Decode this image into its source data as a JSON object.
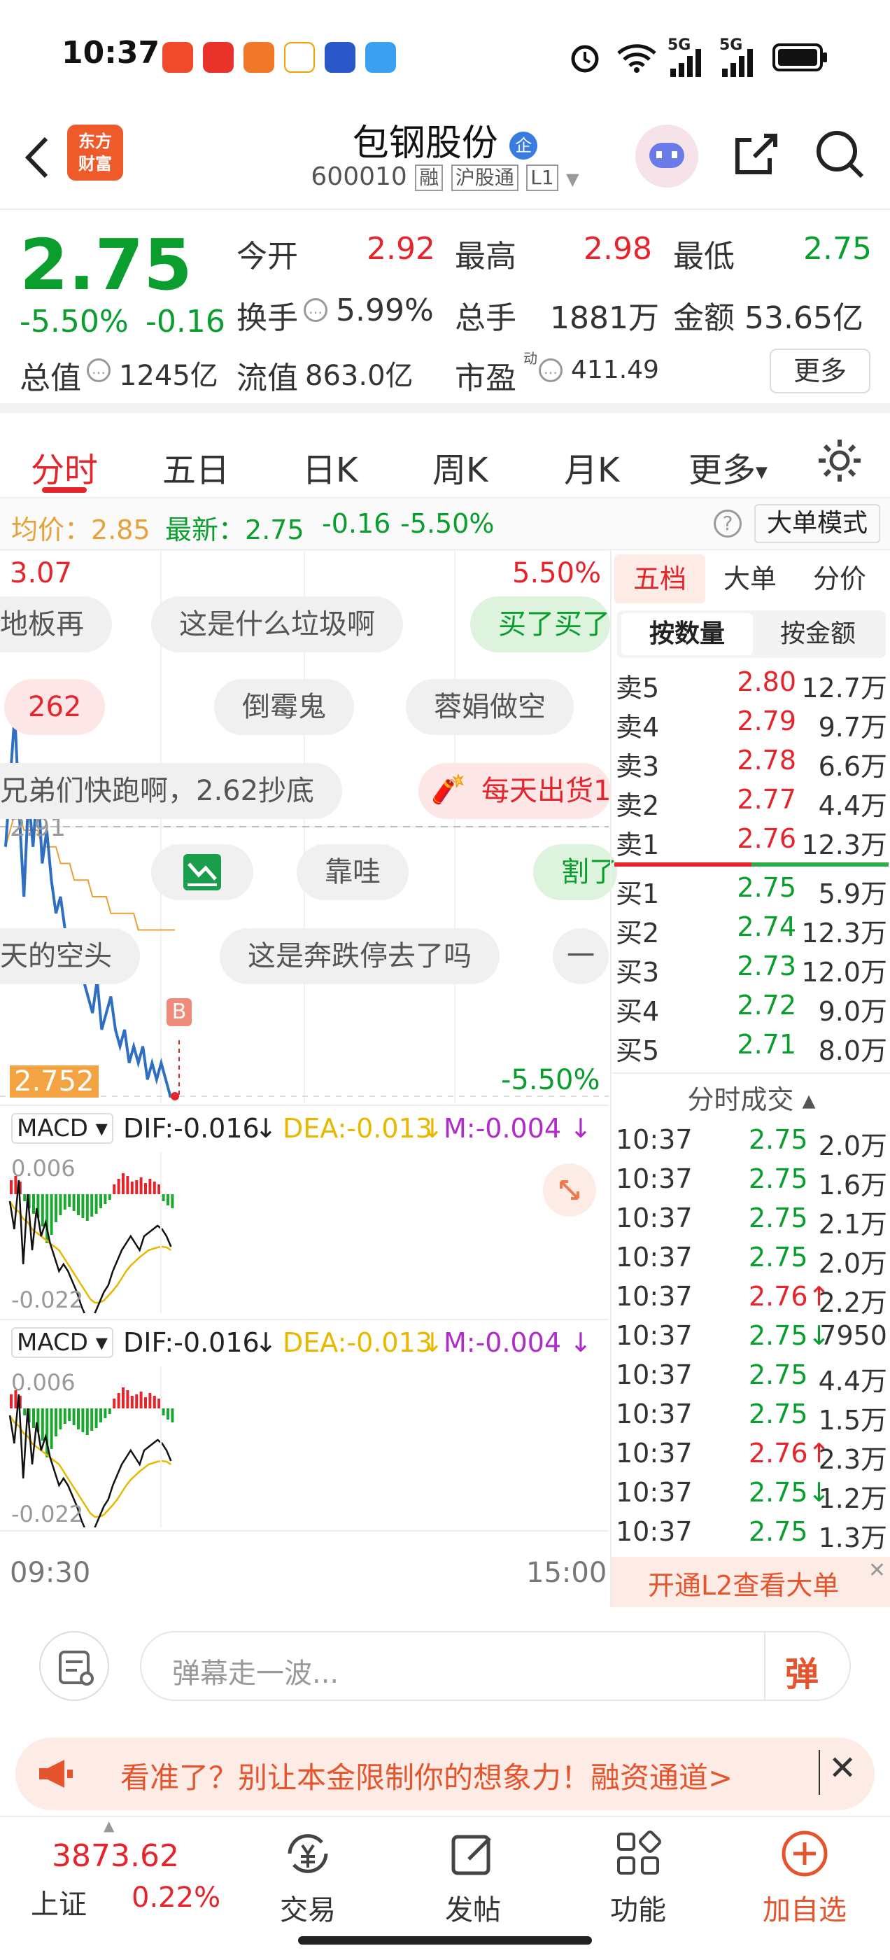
{
  "status": {
    "time": "10:37",
    "signal1": "5G",
    "signal2": "5G"
  },
  "header": {
    "logo_line1": "东方",
    "logo_line2": "财富",
    "name": "包钢股份",
    "badge": "企",
    "code": "600010",
    "tag_rong": "融",
    "tag_hgt": "沪股通",
    "tag_level": "L1"
  },
  "quote": {
    "price": "2.75",
    "change_pct": "-5.50%",
    "change": "-0.16",
    "open_label": "今开",
    "open": "2.92",
    "high_label": "最高",
    "high": "2.98",
    "low_label": "最低",
    "low": "2.75",
    "turnover_label": "换手",
    "turnover": "5.99%",
    "volume_label": "总手",
    "volume": "1881万",
    "amount_label": "金额",
    "amount": "53.65亿",
    "mcap_label": "总值",
    "mcap": "1245亿",
    "float_label": "流值",
    "float": "863.0亿",
    "pe_label": "市盈",
    "pe_sup": "动",
    "pe": "411.49",
    "more": "更多"
  },
  "tabs": [
    "分时",
    "五日",
    "日K",
    "周K",
    "月K",
    "更多"
  ],
  "info": {
    "avg_label": "均价：",
    "avg": "2.85",
    "latest_label": "最新：",
    "latest": "2.75",
    "chg": "-0.16",
    "pct": "-5.50%",
    "bigorder": "大单模式"
  },
  "chart": {
    "max_price": "3.07",
    "max_pct": "5.50%",
    "ref_price": "2.91",
    "min_price": "2.752",
    "min_pct": "-5.50%",
    "b_marker": "B",
    "danmaku": [
      "地板再",
      "这是什么垃圾啊",
      "买了买了",
      "262",
      "倒霉鬼",
      "蓉娟做空",
      "兄弟们快跑啊，2.62抄底",
      "每天出货1",
      "靠哇",
      "割了",
      "天的空头",
      "这是奔跌停去了吗",
      "一"
    ],
    "macd1": {
      "label": "MACD",
      "dif": "DIF:-0.016",
      "dea": "DEA:-0.013",
      "m": "M:-0.004",
      "top": "0.006",
      "bottom": "-0.022"
    },
    "macd2": {
      "label": "MACD",
      "dif": "DIF:-0.016",
      "dea": "DEA:-0.013",
      "m": "M:-0.004",
      "top": "0.006",
      "bottom": "-0.022"
    },
    "time_start": "09:30",
    "time_end": "15:00",
    "price_series": [
      2.9,
      2.94,
      2.98,
      2.92,
      2.87,
      2.93,
      2.9,
      2.94,
      2.89,
      2.91,
      2.88,
      2.86,
      2.87,
      2.85,
      2.84,
      2.83,
      2.84,
      2.82,
      2.81,
      2.8,
      2.82,
      2.79,
      2.8,
      2.81,
      2.79,
      2.78,
      2.79,
      2.77,
      2.78,
      2.77,
      2.78,
      2.76,
      2.77,
      2.76,
      2.77,
      2.76,
      2.75,
      2.75
    ],
    "avg_series": [
      2.9,
      2.91,
      2.92,
      2.92,
      2.91,
      2.91,
      2.91,
      2.91,
      2.9,
      2.9,
      2.9,
      2.9,
      2.89,
      2.89,
      2.89,
      2.88,
      2.88,
      2.88,
      2.88,
      2.87,
      2.87,
      2.87,
      2.87,
      2.86,
      2.86,
      2.86,
      2.86,
      2.86,
      2.86,
      2.85,
      2.85,
      2.85,
      2.85,
      2.85,
      2.85,
      2.85,
      2.85,
      2.85
    ]
  },
  "orderbook": {
    "tabs": [
      "五档",
      "大单",
      "分价"
    ],
    "subtabs": [
      "按数量",
      "按金额"
    ],
    "asks": [
      {
        "label": "卖5",
        "price": "2.80",
        "vol": "12.7万",
        "color": "red"
      },
      {
        "label": "卖4",
        "price": "2.79",
        "vol": "9.7万",
        "color": "red"
      },
      {
        "label": "卖3",
        "price": "2.78",
        "vol": "6.6万",
        "color": "red"
      },
      {
        "label": "卖2",
        "price": "2.77",
        "vol": "4.4万",
        "color": "red"
      },
      {
        "label": "卖1",
        "price": "2.76",
        "vol": "12.3万",
        "color": "red"
      }
    ],
    "bids": [
      {
        "label": "买1",
        "price": "2.75",
        "vol": "5.9万",
        "color": "green"
      },
      {
        "label": "买2",
        "price": "2.74",
        "vol": "12.3万",
        "color": "green"
      },
      {
        "label": "买3",
        "price": "2.73",
        "vol": "12.0万",
        "color": "green"
      },
      {
        "label": "买4",
        "price": "2.72",
        "vol": "9.0万",
        "color": "green"
      },
      {
        "label": "买5",
        "price": "2.71",
        "vol": "8.0万",
        "color": "green"
      }
    ],
    "trades_title": "分时成交",
    "trades": [
      {
        "t": "10:37",
        "p": "2.75",
        "v": "2.0万",
        "c": "green",
        "d": ""
      },
      {
        "t": "10:37",
        "p": "2.75",
        "v": "1.6万",
        "c": "green",
        "d": ""
      },
      {
        "t": "10:37",
        "p": "2.75",
        "v": "2.1万",
        "c": "green",
        "d": ""
      },
      {
        "t": "10:37",
        "p": "2.75",
        "v": "2.0万",
        "c": "green",
        "d": ""
      },
      {
        "t": "10:37",
        "p": "2.76",
        "v": "2.2万",
        "c": "red",
        "d": "↑"
      },
      {
        "t": "10:37",
        "p": "2.75",
        "v": "7950",
        "c": "green",
        "d": "↓"
      },
      {
        "t": "10:37",
        "p": "2.75",
        "v": "4.4万",
        "c": "green",
        "d": ""
      },
      {
        "t": "10:37",
        "p": "2.75",
        "v": "1.5万",
        "c": "green",
        "d": ""
      },
      {
        "t": "10:37",
        "p": "2.76",
        "v": "2.3万",
        "c": "red",
        "d": "↑"
      },
      {
        "t": "10:37",
        "p": "2.75",
        "v": "1.2万",
        "c": "green",
        "d": "↓"
      },
      {
        "t": "10:37",
        "p": "2.75",
        "v": "1.3万",
        "c": "green",
        "d": ""
      }
    ],
    "l2_banner": "开通L2查看大单"
  },
  "comment": {
    "placeholder": "弹幕走一波...",
    "danmu_btn": "弹"
  },
  "ad": {
    "text": "看准了？别让本金限制你的想象力！融资通道>"
  },
  "nav": {
    "index_value": "3873.62",
    "index_name": "上证",
    "index_pct": "0.22%",
    "items": [
      "交易",
      "发帖",
      "功能",
      "加自选"
    ]
  },
  "colors": {
    "up": "#e5242c",
    "down": "#0a9e2e",
    "price_line": "#2f6fc2",
    "avg_line": "#e8a13a",
    "dea": "#e8b800",
    "m": "#b02cc9"
  }
}
